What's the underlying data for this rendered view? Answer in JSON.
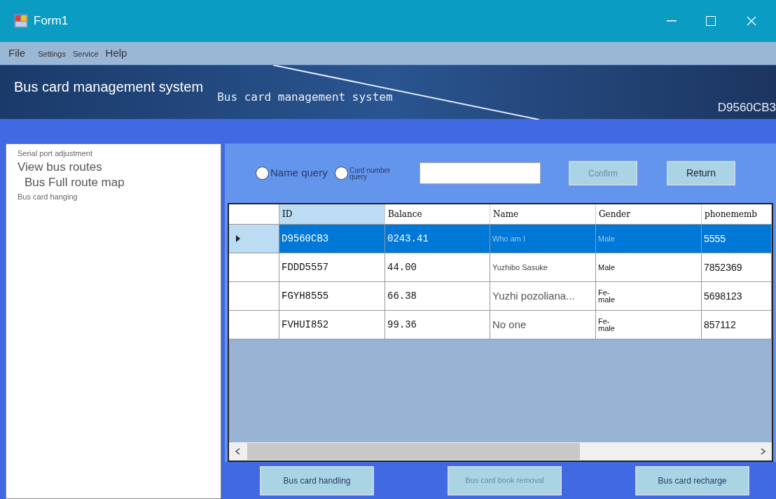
{
  "window": {
    "title": "Form1"
  },
  "menu": [
    "File",
    "Settings",
    "Service",
    "Help"
  ],
  "banner": {
    "title": "Bus card management system",
    "subtitle": "Bus card management system",
    "card_id": "D9560CB3"
  },
  "tree": [
    {
      "label": "Serial port adjustment",
      "kind": "small"
    },
    {
      "label": "View bus routes",
      "kind": "large",
      "children": [
        {
          "label": "Bus Full route map",
          "kind": "large"
        }
      ]
    },
    {
      "label": "Bus card hanging",
      "kind": "small"
    }
  ],
  "query": {
    "options": [
      {
        "label": "Name query",
        "selected": false
      },
      {
        "label": "Card number query",
        "selected": false
      }
    ],
    "confirm": "Confirm",
    "return": "Return"
  },
  "table": {
    "columns": [
      "ID",
      "Balance",
      "Name",
      "Gender",
      "phonememb"
    ],
    "rows": [
      {
        "selected": true,
        "cells": [
          "D9560CB3",
          "0243.41",
          "Who am I",
          "Male",
          "5555"
        ]
      },
      {
        "selected": false,
        "cells": [
          "FDDD5557",
          "44.00",
          "Yuzhibo Sasuke",
          "Male",
          "7852369"
        ]
      },
      {
        "selected": false,
        "cells": [
          "FGYH8555",
          "66.38",
          "Yuzhi pozoliana...",
          "Fe-\nmale",
          "5698123"
        ]
      },
      {
        "selected": false,
        "cells": [
          "FVHUI852",
          "99.36",
          "No one",
          "Fe-\nmale",
          "857112"
        ]
      }
    ]
  },
  "actions": [
    "Bus card handling",
    "Bus card book removal",
    "Bus card recharge"
  ]
}
